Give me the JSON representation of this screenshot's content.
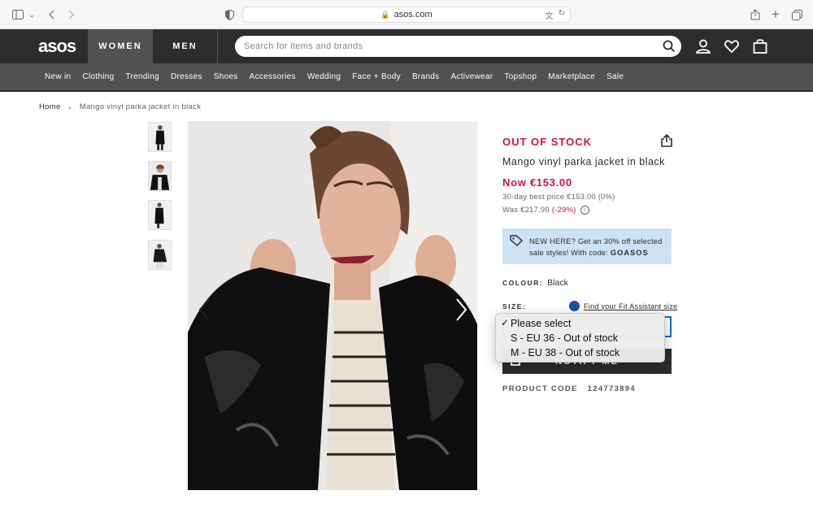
{
  "browser": {
    "url": "asos.com"
  },
  "header": {
    "logo": "asos",
    "women_tab": "WOMEN",
    "men_tab": "MEN",
    "search_placeholder": "Search for items and brands"
  },
  "nav": {
    "items": [
      "New in",
      "Clothing",
      "Trending",
      "Dresses",
      "Shoes",
      "Accessories",
      "Wedding",
      "Face + Body",
      "Brands",
      "Activewear",
      "Topshop",
      "Marketplace",
      "Sale"
    ]
  },
  "breadcrumb": {
    "home": "Home",
    "current": "Mango vinyl parka jacket in black"
  },
  "product": {
    "stock_status": "OUT OF STOCK",
    "name": "Mango vinyl parka jacket in black",
    "now_price": "Now €153.00",
    "best_price": "30-day best price €153.00 (0%)",
    "was_price": "Was €217.99",
    "discount": "(-29%)",
    "promo_text": "NEW HERE? Get an 30% off selected sale styles! With code:",
    "promo_code": "GOASOS",
    "colour_label": "COLOUR:",
    "colour_value": "Black",
    "size_label": "SIZE:",
    "fit_assistant": "Find your Fit Assistant size",
    "notify_button": "NOTIFY ME",
    "code_label": "PRODUCT CODE",
    "code_value": "124773894"
  },
  "size_dropdown": {
    "options": [
      "Please select",
      "S - EU 36 - Out of stock",
      "M - EU 38 - Out of stock"
    ],
    "selected_index": 0
  },
  "colors": {
    "brand_dark": "#2d2d2d",
    "nav_grey": "#525050",
    "sale_red": "#d01345",
    "promo_blue": "#cde2f5",
    "focus_blue": "#0770cf"
  }
}
